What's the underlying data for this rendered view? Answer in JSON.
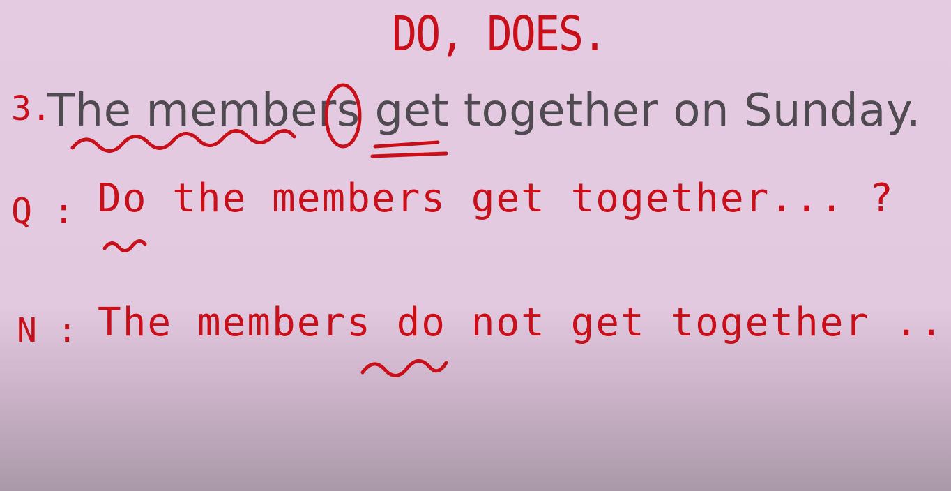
{
  "title": "DO, DOES.",
  "example": {
    "number": "3.",
    "sentence": "The members get together on Sunday."
  },
  "question": {
    "label": "Q :",
    "text": "Do the members get together... ?"
  },
  "negative": {
    "label": "N :",
    "text": "The members do not get together ...."
  },
  "colors": {
    "ink_red": "#c9101a",
    "typed_text": "#4f4b50",
    "board_bg": "#e4cbe1"
  }
}
